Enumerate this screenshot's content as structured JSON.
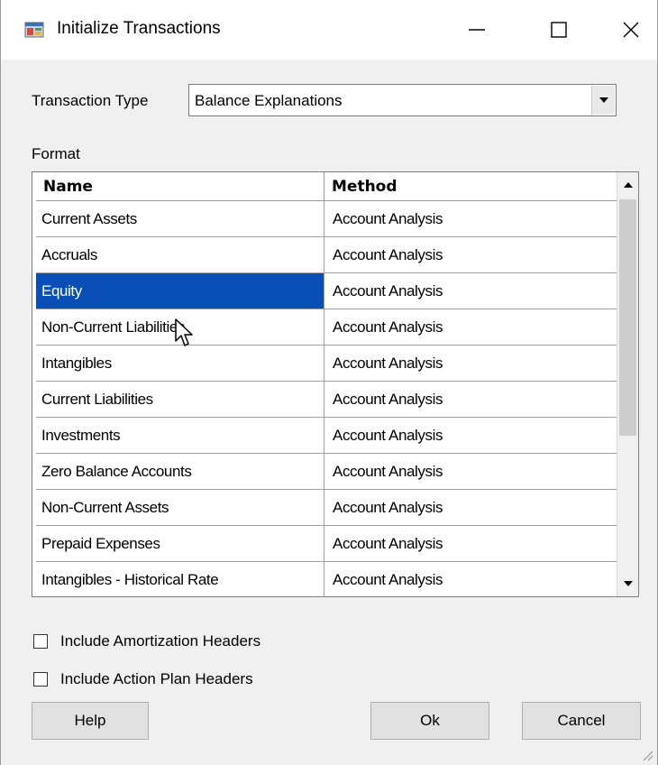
{
  "window": {
    "title": "Initialize Transactions",
    "icon": "app-window-icon",
    "controls": [
      "minimize-icon",
      "maximize-icon",
      "close-icon"
    ]
  },
  "transaction_type": {
    "label": "Transaction Type",
    "value": "Balance Explanations"
  },
  "format": {
    "label": "Format",
    "columns": {
      "name": "Name",
      "method": "Method"
    },
    "rows": [
      {
        "name": "Current Assets",
        "method": "Account Analysis"
      },
      {
        "name": "Accruals",
        "method": "Account Analysis"
      },
      {
        "name": "Equity",
        "method": "Account Analysis"
      },
      {
        "name": "Non-Current Liabilities",
        "method": "Account Analysis"
      },
      {
        "name": "Intangibles",
        "method": "Account Analysis"
      },
      {
        "name": "Current Liabilities",
        "method": "Account Analysis"
      },
      {
        "name": "Investments",
        "method": "Account Analysis"
      },
      {
        "name": "Zero Balance Accounts",
        "method": "Account Analysis"
      },
      {
        "name": "Non-Current Assets",
        "method": "Account Analysis"
      },
      {
        "name": "Prepaid Expenses",
        "method": "Account Analysis"
      },
      {
        "name": "Intangibles - Historical Rate",
        "method": "Account Analysis"
      }
    ],
    "selected_row": 2
  },
  "options": {
    "amortization_headers": {
      "label": "Include Amortization Headers",
      "checked": false
    },
    "action_plan_headers": {
      "label": "Include Action Plan Headers",
      "checked": false
    }
  },
  "buttons": {
    "help": "Help",
    "ok": "Ok",
    "cancel": "Cancel"
  },
  "colors": {
    "selection": "#0a4fb8",
    "window_bg": "#f0f0f0"
  }
}
